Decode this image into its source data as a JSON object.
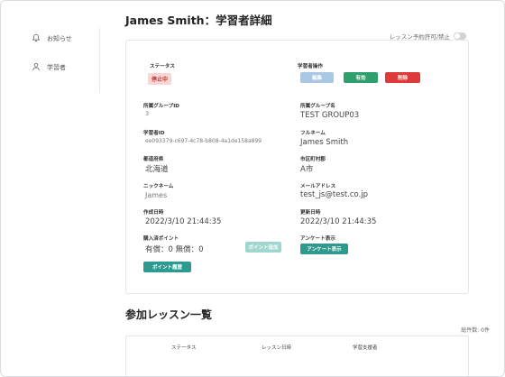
{
  "sidebar": {
    "items": [
      {
        "label": "お知らせ",
        "icon": "bell-icon"
      },
      {
        "label": "学習者",
        "icon": "user-icon"
      }
    ]
  },
  "header": {
    "title": "James Smith：学習者詳細"
  },
  "toggle": {
    "label": "レッスン予約許可/禁止",
    "state": "off"
  },
  "detail": {
    "status_label": "ステータス",
    "status_value": "停止中",
    "ops_label": "学習者操作",
    "ops_buttons": [
      "編集",
      "有効",
      "削除"
    ],
    "group_id_label": "所属グループID",
    "group_id_value": "3",
    "group_name_label": "所属グループ名",
    "group_name_value": "TEST GROUP03",
    "learner_id_label": "学習者ID",
    "learner_id_value": "ee093379-c697-4c78-b808-4a1de158a899",
    "fullname_label": "フルネーム",
    "fullname_value": "James Smith",
    "prefecture_label": "都道府県",
    "prefecture_value": "北海道",
    "city_label": "市区町村郡",
    "city_value": "A市",
    "nickname_label": "ニックネーム",
    "nickname_value": "James",
    "email_label": "メールアドレス",
    "email_value": "test_js@test.co.jp",
    "created_label": "作成日時",
    "created_value": "2022/3/10 21:44:35",
    "updated_label": "更新日時",
    "updated_value": "2022/3/10 21:44:35",
    "points_label": "購入済ポイント",
    "points_value": "有償：0 無償：0",
    "points_add_button": "ポイント追加",
    "points_history_button": "ポイント履歴",
    "survey_label": "アンケート表示",
    "survey_button": "アンケート表示"
  },
  "lessons": {
    "title": "参加レッスン一覧",
    "total": "総件数: 0件",
    "columns": [
      "ステータス",
      "レッスン日時",
      "学習支援者"
    ]
  },
  "colors": {
    "teal": "#2e9a8f",
    "teal_light": "#9fd6cd",
    "edit_blue": "#a8c8e6",
    "green": "#2e9f6d",
    "red": "#dd3a3a"
  }
}
